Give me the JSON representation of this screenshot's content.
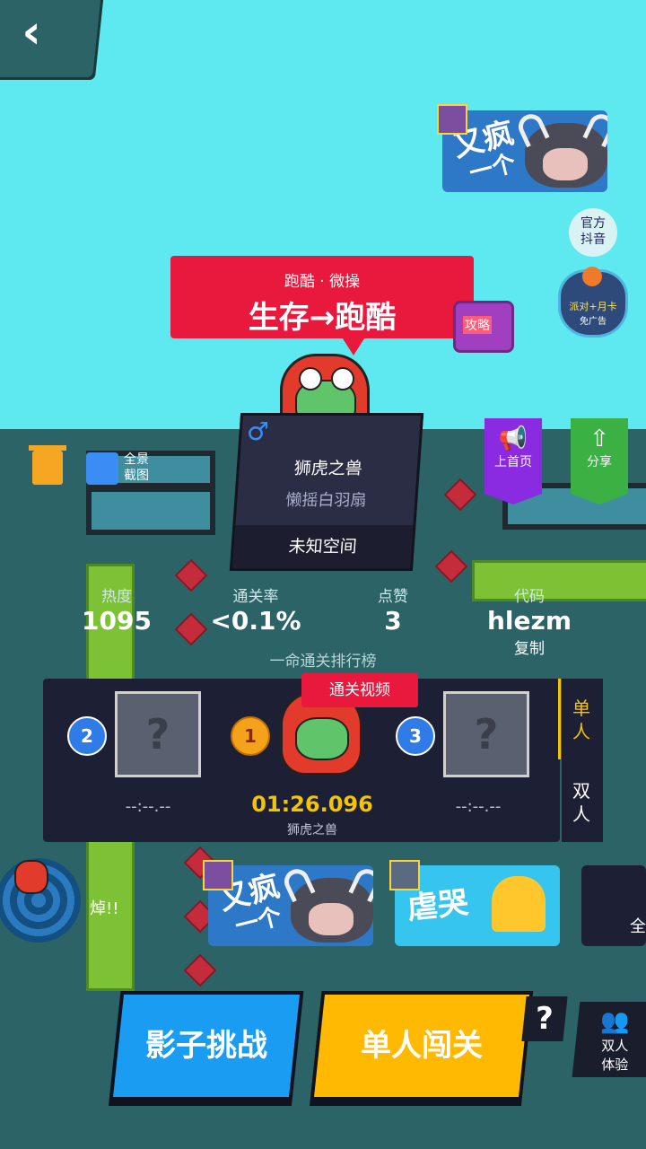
{
  "header": {
    "back_icon": "‹"
  },
  "top_promo": {
    "line1": "又疯",
    "line2": "一个"
  },
  "official_douyin": {
    "line1": "官方",
    "line2": "抖音"
  },
  "ad_badge": {
    "line1": "派对+月卡",
    "line2": "免广告"
  },
  "level_title": {
    "subtitle": "跑酷 · 微操",
    "title": "生存→跑酷"
  },
  "guide_tv": {
    "label": "攻略"
  },
  "creator": {
    "name": "狮虎之兽",
    "motto": "懒摇白羽扇",
    "gender_icon": "♂",
    "space": "未知空间"
  },
  "tools": {
    "screenshot_line1": "全景",
    "screenshot_line2": "截图"
  },
  "side_actions": {
    "homepage": "上首页",
    "share": "分享"
  },
  "stats": {
    "heat_label": "热度",
    "heat_value": "1095",
    "pass_rate_label": "通关率",
    "pass_rate_value": "<0.1%",
    "likes_label": "点赞",
    "likes_value": "3",
    "code_label": "代码",
    "code_value": "hlezm",
    "copy_label": "复制"
  },
  "leaderboard": {
    "title": "一命通关排行榜",
    "clear_video": "通关视频",
    "tabs": [
      "单人",
      "双人"
    ],
    "entries": [
      {
        "rank": "2",
        "time": "--:--.--"
      },
      {
        "rank": "1",
        "time": "01:26.096",
        "name": "狮虎之兽"
      },
      {
        "rank": "3",
        "time": "--:--.--"
      }
    ],
    "empty_slot_glyph": "?"
  },
  "recommend": {
    "shout": "焯!!",
    "card1_line1": "又疯",
    "card1_line2": "一个",
    "card2_text": "虐哭",
    "card3_text": "全"
  },
  "actions": {
    "shadow_challenge": "影子挑战",
    "single_play": "单人闯关",
    "help": "?",
    "duo_line1": "双人",
    "duo_line2": "体验"
  },
  "colors": {
    "sky": "#5ee9f0",
    "ground": "#2b6366",
    "accent_red": "#e8193c",
    "gold": "#f5c400"
  }
}
